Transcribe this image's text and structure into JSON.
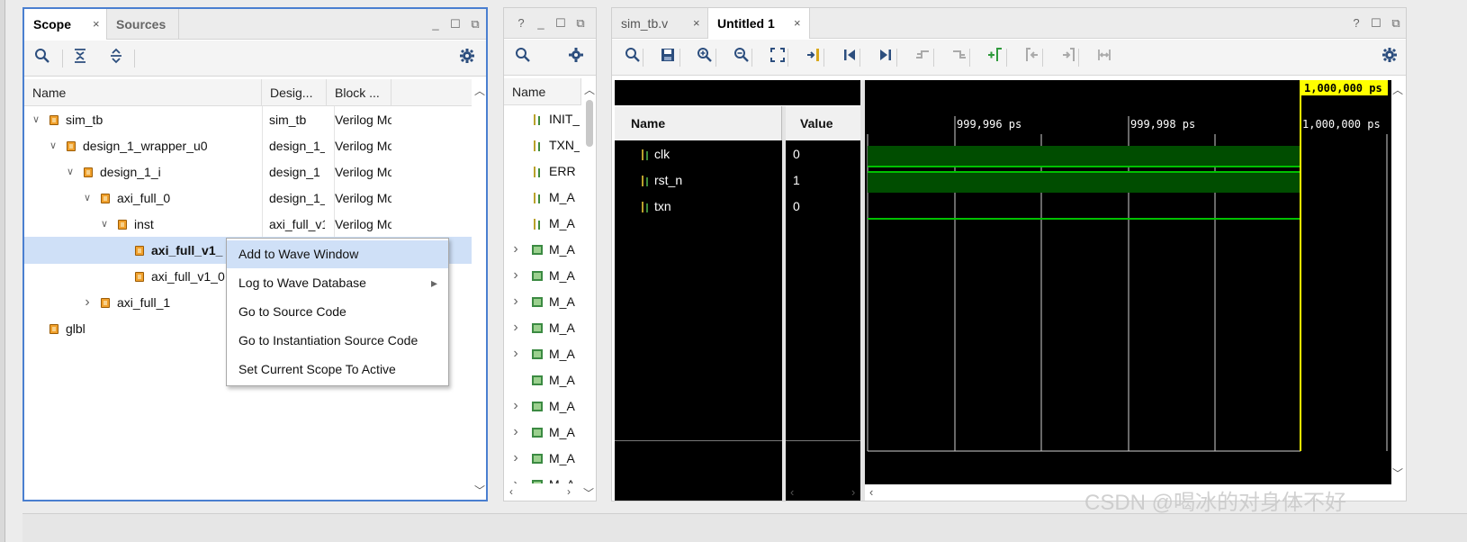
{
  "scope_panel": {
    "tabs": [
      {
        "label": "Scope"
      },
      {
        "label": "Sources"
      }
    ],
    "tab_close": "×",
    "window_buttons": [
      "_",
      "☐",
      "⧉"
    ],
    "toolbar_icons": [
      "search-icon",
      "collapse-all-icon",
      "expand-all-icon",
      "gear-icon"
    ],
    "columns": [
      "Name",
      "Desig...",
      "Block ..."
    ],
    "rows": [
      {
        "name": "sim_tb",
        "design": "sim_tb",
        "block": "Verilog Mo",
        "level": 0,
        "toggle": "expanded"
      },
      {
        "name": "design_1_wrapper_u0",
        "design": "design_1_",
        "block": "Verilog Mo",
        "level": 1,
        "toggle": "expanded"
      },
      {
        "name": "design_1_i",
        "design": "design_1",
        "block": "Verilog Mo",
        "level": 2,
        "toggle": "expanded"
      },
      {
        "name": "axi_full_0",
        "design": "design_1_",
        "block": "Verilog Mo",
        "level": 3,
        "toggle": "expanded"
      },
      {
        "name": "inst",
        "design": "axi_full_v1",
        "block": "Verilog Mo",
        "level": 4,
        "toggle": "expanded"
      },
      {
        "name": "axi_full_v1_",
        "design": "",
        "block": "",
        "level": 5,
        "toggle": "none",
        "selected": true
      },
      {
        "name": "axi_full_v1_0",
        "design": "",
        "block": "",
        "level": 5,
        "toggle": "none"
      },
      {
        "name": "axi_full_1",
        "design": "",
        "block": "",
        "level": 3,
        "toggle": "collapsed"
      },
      {
        "name": "glbl",
        "design": "",
        "block": "",
        "level": 0,
        "toggle": "none"
      }
    ]
  },
  "context_menu": {
    "items": [
      {
        "label": "Add to Wave Window",
        "highlighted": true,
        "submenu": false
      },
      {
        "label": "Log to Wave Database",
        "highlighted": false,
        "submenu": true
      },
      {
        "label": "Go to Source Code",
        "highlighted": false,
        "submenu": false
      },
      {
        "label": "Go to Instantiation Source Code",
        "highlighted": false,
        "submenu": false
      },
      {
        "label": "Set Current Scope To Active",
        "highlighted": false,
        "submenu": false
      }
    ],
    "submenu_arrow": "▸"
  },
  "objects_panel": {
    "window_buttons": [
      "?",
      "_",
      "☐",
      "⧉"
    ],
    "column": "Name",
    "rows": [
      {
        "name": "INIT_",
        "kind": "signal",
        "toggle": false
      },
      {
        "name": "TXN_",
        "kind": "signal",
        "toggle": false
      },
      {
        "name": "ERR",
        "kind": "signal",
        "toggle": false
      },
      {
        "name": "M_A",
        "kind": "signal",
        "toggle": false
      },
      {
        "name": "M_A",
        "kind": "signal",
        "toggle": false
      },
      {
        "name": "M_A",
        "kind": "bus",
        "toggle": true
      },
      {
        "name": "M_A",
        "kind": "bus",
        "toggle": true
      },
      {
        "name": "M_A",
        "kind": "bus",
        "toggle": true
      },
      {
        "name": "M_A",
        "kind": "bus",
        "toggle": true
      },
      {
        "name": "M_A",
        "kind": "bus",
        "toggle": true
      },
      {
        "name": "M_A",
        "kind": "bus",
        "toggle": false
      },
      {
        "name": "M_A",
        "kind": "bus",
        "toggle": true
      },
      {
        "name": "M_A",
        "kind": "bus",
        "toggle": true
      },
      {
        "name": "M_A",
        "kind": "bus",
        "toggle": true
      },
      {
        "name": "M_A",
        "kind": "bus",
        "toggle": true
      }
    ]
  },
  "wave_panel": {
    "tabs": [
      {
        "label": "sim_tb.v",
        "active": false
      },
      {
        "label": "Untitled 1",
        "active": true
      }
    ],
    "tab_close": "×",
    "window_buttons": [
      "?",
      "☐",
      "⧉"
    ],
    "toolbar_icons": [
      "search-icon",
      "save-icon",
      "zoom-in-icon",
      "zoom-out-icon",
      "zoom-fit-icon",
      "go-to-cursor-icon",
      "go-to-start-icon",
      "go-to-end-icon",
      "previous-transition-icon",
      "next-transition-icon",
      "add-marker-icon",
      "previous-marker-icon",
      "next-marker-icon",
      "swap-cursors-icon",
      "gear-icon"
    ],
    "name_header": "Name",
    "value_header": "Value",
    "cursor_label": "1,000,000 ps",
    "time_ticks": [
      "999,996 ps",
      "999,998 ps",
      "1,000,000 ps"
    ],
    "signals": [
      {
        "name": "clk",
        "value": "0"
      },
      {
        "name": "rst_n",
        "value": "1"
      },
      {
        "name": "txn",
        "value": "0"
      }
    ],
    "colors": {
      "wave_bg": "#000000",
      "wave_green": "#00c000",
      "cursor": "#ffff00",
      "bus_fill": "#004d00"
    }
  },
  "watermark": "CSDN @喝冰的对身体不好"
}
